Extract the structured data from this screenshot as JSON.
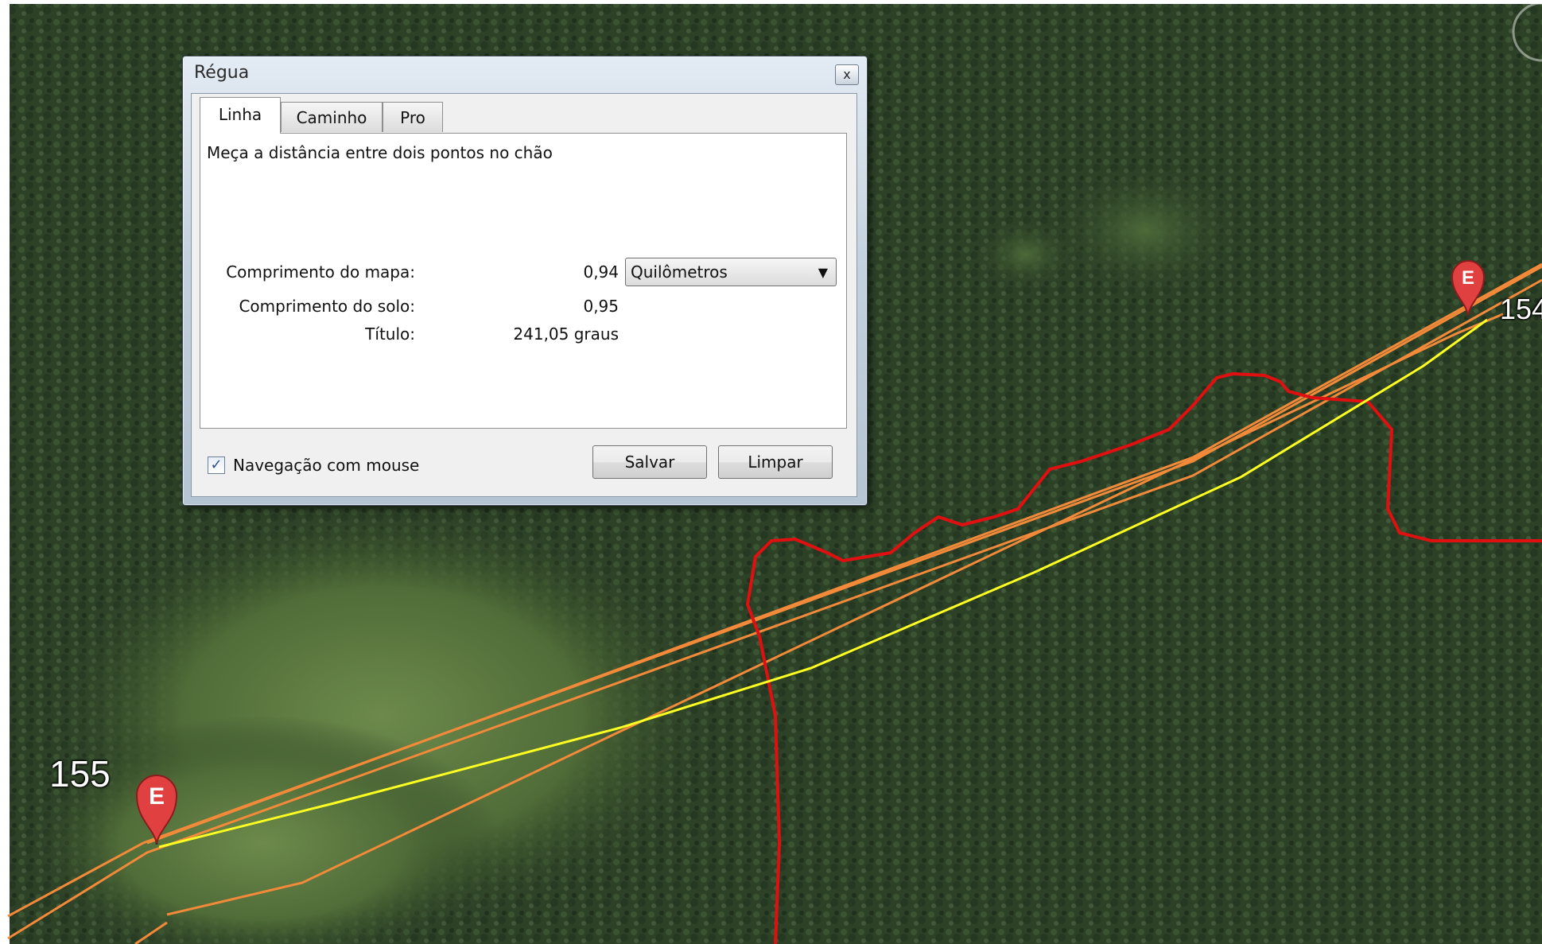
{
  "map": {
    "placemark_label_left": "155",
    "placemark_label_right": "154",
    "placemark_letter": "E",
    "colors": {
      "route_orange": "#f28a3a",
      "path_red": "#e01010",
      "measure_yellow": "#ffff22",
      "placemark_red": "#e04040"
    }
  },
  "dialog": {
    "title": "Régua",
    "close_label": "x",
    "tabs": [
      {
        "label": "Linha",
        "active": true
      },
      {
        "label": "Caminho",
        "active": false
      },
      {
        "label": "Pro",
        "active": false
      }
    ],
    "instructions": "Meça a distância entre dois pontos no chão",
    "map_length_label": "Comprimento do mapa:",
    "map_length_value": "0,94",
    "ground_length_label": "Comprimento do solo:",
    "ground_length_value": "0,95",
    "heading_label": "Título:",
    "heading_value": "241,05 graus",
    "unit_select": "Quilômetros",
    "mouse_nav_label": "Navegação com mouse",
    "mouse_nav_checked": true,
    "save_label": "Salvar",
    "clear_label": "Limpar"
  }
}
